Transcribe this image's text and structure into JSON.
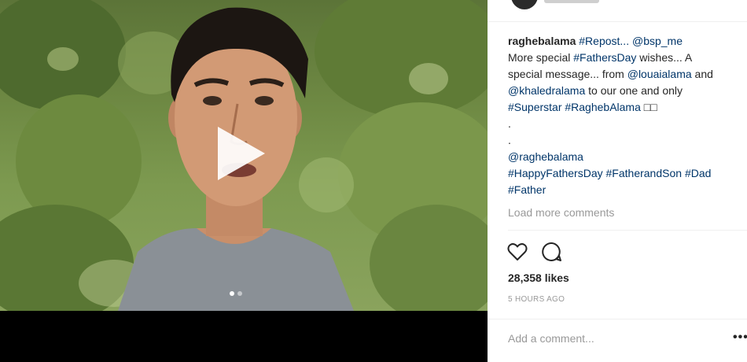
{
  "post": {
    "caption": {
      "username": "raghebalama",
      "line1_tag": "#Repost...",
      "line1_mention": "@bsp_me",
      "line2_text": "More special ",
      "line2_tag": "#FathersDay",
      "line2_text2": " wishes... A",
      "line3_text": "special message... from ",
      "line3_mention": "@louaialama",
      "line3_text2": " and",
      "line4_mention": "@khaledralama",
      "line4_text": " to our one and only",
      "line5_tag1": "#Superstar",
      "line5_tag2": "#RaghebAlama",
      "line5_emoji": "□□",
      "dot1": ".",
      "dot2": ".",
      "line8_mention": "@raghebalama",
      "line9_tag1": "#HappyFathersDay",
      "line9_tag2": "#FatherandSon",
      "line9_tag3": "#Dad",
      "line10_tag": "#Father"
    },
    "load_more": "Load more comments",
    "likes": "28,358 likes",
    "timestamp": "5 HOURS AGO",
    "comment_placeholder": "Add a comment...",
    "more_label": "•••"
  },
  "media": {
    "type": "video",
    "carousel_count": 2,
    "carousel_active": 1
  },
  "icons": {
    "play": "play-icon",
    "like": "heart-icon",
    "comment": "comment-icon",
    "more": "more-options-icon"
  }
}
